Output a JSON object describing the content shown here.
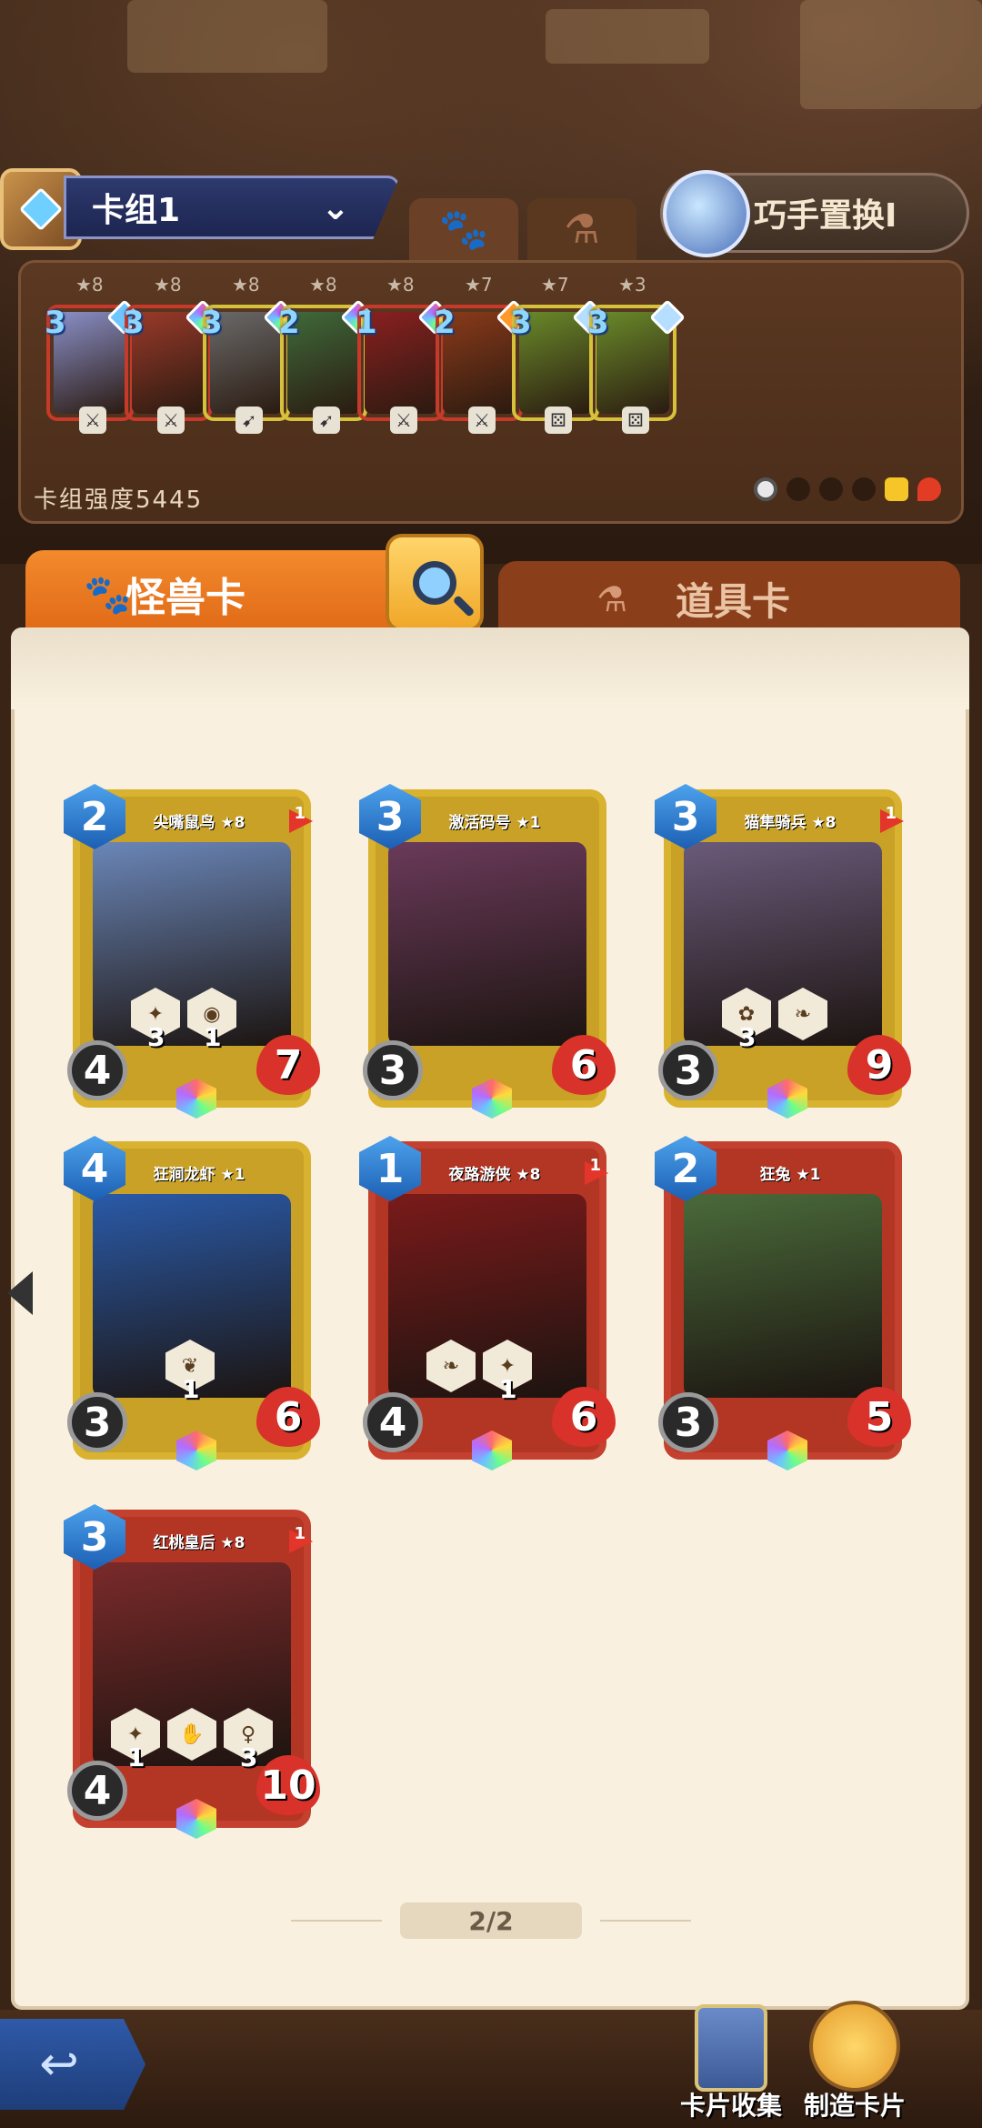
{
  "deck": {
    "name": "卡组1",
    "power_label": "卡组强度5445",
    "type_tabs": [
      "paw",
      "potion"
    ],
    "swap_label": "巧手置换I",
    "cards": [
      {
        "cost": "3",
        "stars": "★8",
        "frame": "red",
        "art": "#8a8fc8",
        "gem": "#6fc6ff",
        "icon": "sword"
      },
      {
        "cost": "3",
        "stars": "★8",
        "frame": "red",
        "art": "#9a3a2a",
        "gem": "rainbow",
        "icon": "sword"
      },
      {
        "cost": "3",
        "stars": "★8",
        "frame": "yellow",
        "art": "#6a6a6a",
        "gem": "rainbow",
        "icon": "bow"
      },
      {
        "cost": "2",
        "stars": "★8",
        "frame": "yellow",
        "art": "#3f6a3a",
        "gem": "rainbow",
        "icon": "bow"
      },
      {
        "cost": "1",
        "stars": "★8",
        "frame": "red",
        "art": "#8a2020",
        "gem": "rainbow",
        "icon": "sword"
      },
      {
        "cost": "2",
        "stars": "★7",
        "frame": "red",
        "art": "#8a3a1a",
        "gem": "#ff9a2a",
        "icon": "sword"
      },
      {
        "cost": "3",
        "stars": "★7",
        "frame": "yellow",
        "art": "#6a8a2a",
        "gem": "#b6dfff",
        "icon": "dice"
      },
      {
        "cost": "3",
        "stars": "★3",
        "frame": "yellow",
        "art": "#6a8a2a",
        "gem": "#b6dfff",
        "icon": "dice"
      }
    ]
  },
  "tabs": {
    "monster": "怪兽卡",
    "item": "道具卡"
  },
  "cards": [
    {
      "name": "尖嘴鼠鸟 ★8",
      "cost": "2",
      "atk": "4",
      "hp": "7",
      "frame": "yellow",
      "flag": "1",
      "art": "#6a86b8",
      "abilities": [
        {
          "icon": "✦",
          "num": "3"
        },
        {
          "icon": "◉",
          "num": "1"
        }
      ]
    },
    {
      "name": "激活码号 ★1",
      "cost": "3",
      "atk": "3",
      "hp": "6",
      "frame": "yellow",
      "flag": "",
      "art": "#6a3a5a",
      "abilities": []
    },
    {
      "name": "猫隼骑兵 ★8",
      "cost": "3",
      "atk": "3",
      "hp": "9",
      "frame": "yellow",
      "flag": "1",
      "art": "#6a5a7a",
      "abilities": [
        {
          "icon": "✿",
          "num": "3"
        },
        {
          "icon": "❧",
          "num": ""
        }
      ]
    },
    {
      "name": "狂涧龙虾 ★1",
      "cost": "4",
      "atk": "3",
      "hp": "6",
      "frame": "yellow",
      "flag": "",
      "art": "#2a5aa8",
      "abilities": [
        {
          "icon": "❦",
          "num": "1"
        }
      ]
    },
    {
      "name": "夜路游侠 ★8",
      "cost": "1",
      "atk": "4",
      "hp": "6",
      "frame": "red",
      "flag": "1",
      "art": "#7a1a1a",
      "abilities": [
        {
          "icon": "❧",
          "num": ""
        },
        {
          "icon": "✦",
          "num": "1"
        }
      ]
    },
    {
      "name": "狂兔 ★1",
      "cost": "2",
      "atk": "3",
      "hp": "5",
      "frame": "red",
      "flag": "",
      "art": "#4a6a3a",
      "abilities": []
    },
    {
      "name": "红桃皇后 ★8",
      "cost": "3",
      "atk": "4",
      "hp": "10",
      "frame": "red",
      "flag": "1",
      "art": "#7a2a2a",
      "abilities": [
        {
          "icon": "✦",
          "num": "1"
        },
        {
          "icon": "✋",
          "num": ""
        },
        {
          "icon": "♀",
          "num": "3"
        }
      ]
    }
  ],
  "pager": "2/2",
  "bottom": {
    "collect_label": "卡片收集",
    "make_label": "制造卡片",
    "back_icon": "back-arrow-icon"
  }
}
